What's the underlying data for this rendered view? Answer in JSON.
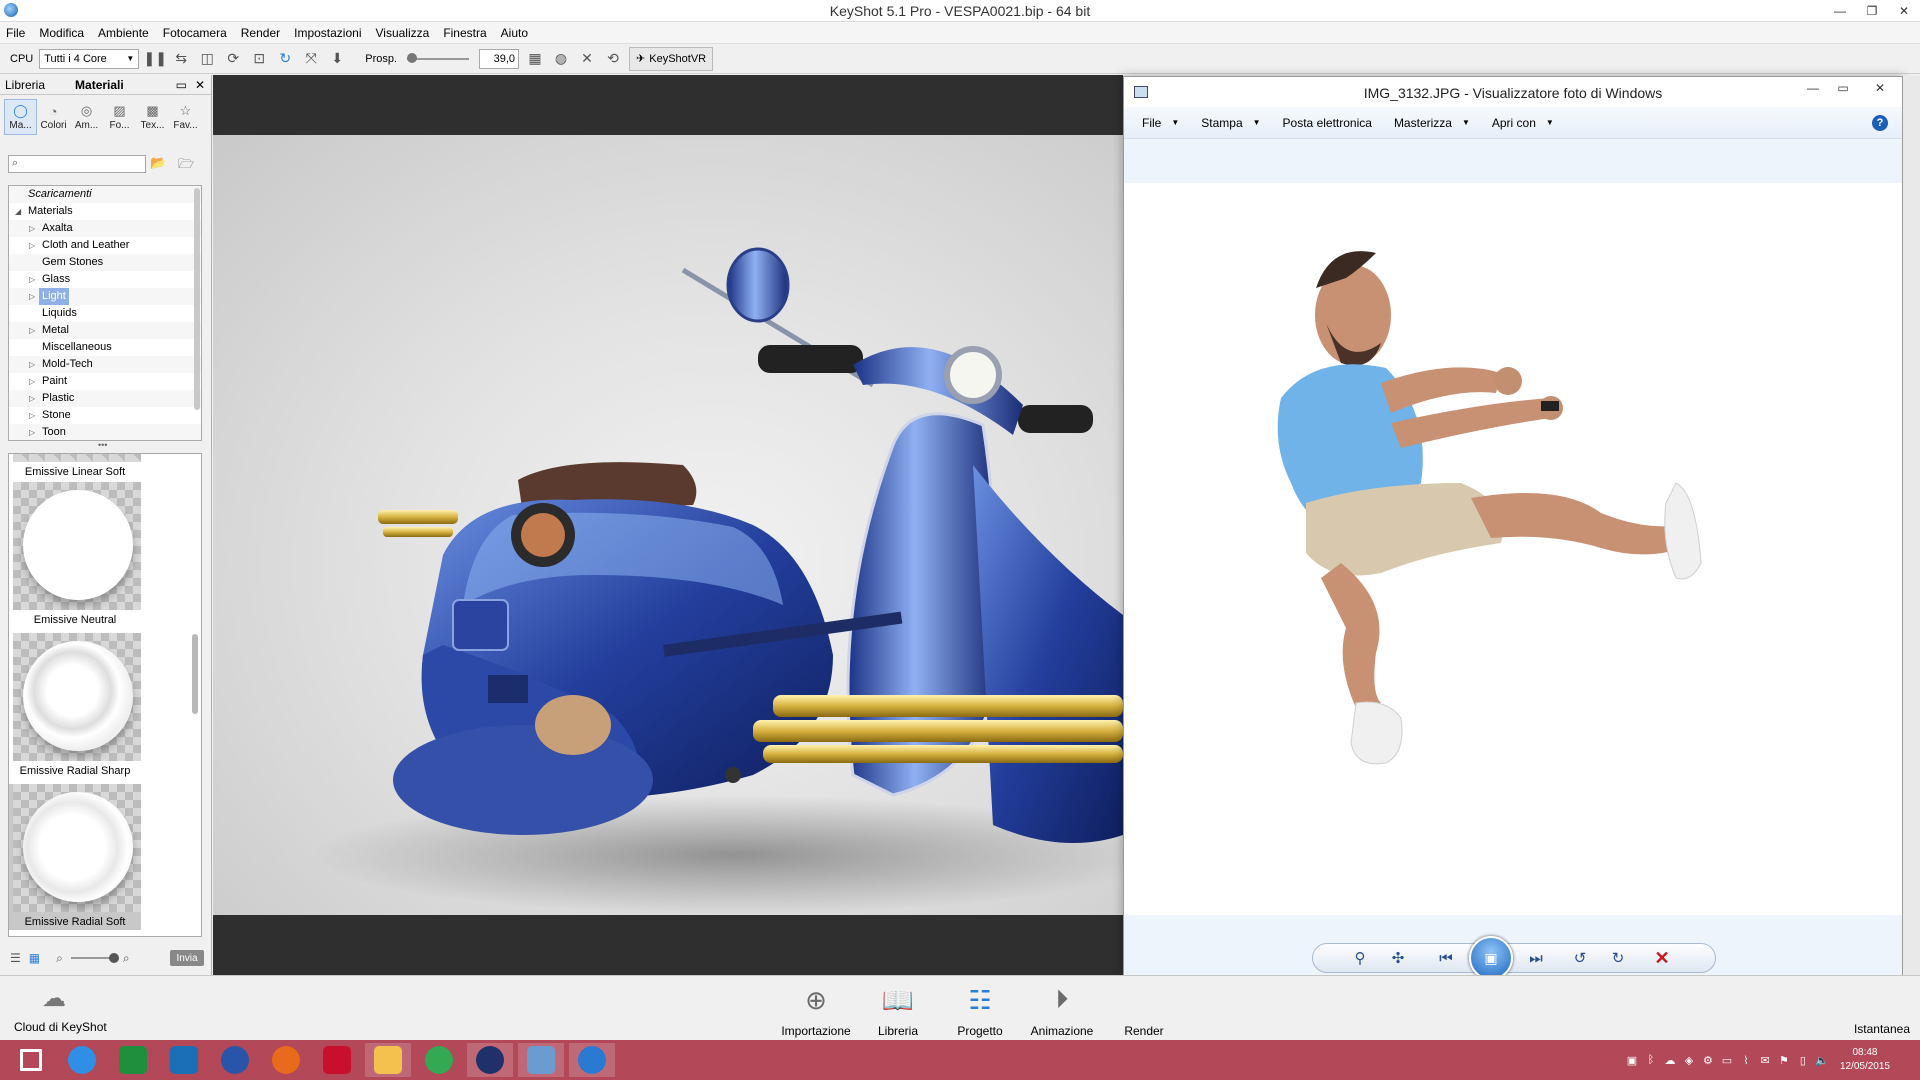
{
  "window": {
    "title": "KeyShot 5.1 Pro  - VESPA0021.bip  - 64 bit",
    "controls": [
      "—",
      "❐",
      "✕"
    ]
  },
  "menubar": [
    "File",
    "Modifica",
    "Ambiente",
    "Fotocamera",
    "Render",
    "Impostazioni",
    "Visualizza",
    "Finestra",
    "Aiuto"
  ],
  "toolbar": {
    "cpu_label": "CPU",
    "cpu_select": "Tutti i 4 Core",
    "persp_label": "Prosp.",
    "persp_value": "39,0",
    "keyshotvr_label": "KeyShotVR"
  },
  "library": {
    "tabs": [
      "Libreria",
      "Materiali"
    ],
    "categories": [
      {
        "label": "Ma...",
        "icon": "materials-icon"
      },
      {
        "label": "Colori",
        "icon": "colors-icon"
      },
      {
        "label": "Am...",
        "icon": "environments-icon"
      },
      {
        "label": "Fo...",
        "icon": "backplates-icon"
      },
      {
        "label": "Tex...",
        "icon": "textures-icon"
      },
      {
        "label": "Fav...",
        "icon": "favorites-icon"
      }
    ],
    "search_placeholder": "",
    "tree": [
      {
        "label": "Scaricamenti",
        "level": 0,
        "arrow": "",
        "italic": true
      },
      {
        "label": "Materials",
        "level": 0,
        "arrow": "◢"
      },
      {
        "label": "Axalta",
        "level": 1,
        "arrow": "▷"
      },
      {
        "label": "Cloth and Leather",
        "level": 1,
        "arrow": "▷"
      },
      {
        "label": "Gem Stones",
        "level": 1,
        "arrow": ""
      },
      {
        "label": "Glass",
        "level": 1,
        "arrow": "▷"
      },
      {
        "label": "Light",
        "level": 1,
        "arrow": "▷",
        "selected": true
      },
      {
        "label": "Liquids",
        "level": 1,
        "arrow": ""
      },
      {
        "label": "Metal",
        "level": 1,
        "arrow": "▷"
      },
      {
        "label": "Miscellaneous",
        "level": 1,
        "arrow": ""
      },
      {
        "label": "Mold-Tech",
        "level": 1,
        "arrow": "▷"
      },
      {
        "label": "Paint",
        "level": 1,
        "arrow": "▷"
      },
      {
        "label": "Plastic",
        "level": 1,
        "arrow": "▷"
      },
      {
        "label": "Stone",
        "level": 1,
        "arrow": "▷"
      },
      {
        "label": "Toon",
        "level": 1,
        "arrow": "▷"
      }
    ],
    "thumbnails": [
      {
        "label": "Emissive Linear Soft"
      },
      {
        "label": "Emissive Neutral"
      },
      {
        "label": "Emissive Radial Sharp"
      },
      {
        "label": "Emissive Radial Soft",
        "selected": true
      }
    ],
    "send_label": "Invia"
  },
  "dock": {
    "cloud_label": "Cloud di KeyShot",
    "items": [
      {
        "label": "Importazione",
        "icon": "import-icon"
      },
      {
        "label": "Libreria",
        "icon": "library-icon"
      },
      {
        "label": "Progetto",
        "icon": "project-icon"
      },
      {
        "label": "Animazione",
        "icon": "animation-icon"
      },
      {
        "label": "Render",
        "icon": "render-icon"
      }
    ],
    "snapshot_label": "Istantanea"
  },
  "viewer": {
    "title": "IMG_3132.JPG - Visualizzatore foto di Windows",
    "menu": [
      {
        "label": "File",
        "dropdown": true
      },
      {
        "label": "Stampa",
        "dropdown": true
      },
      {
        "label": "Posta elettronica",
        "dropdown": false
      },
      {
        "label": "Masterizza",
        "dropdown": true
      },
      {
        "label": "Apri con",
        "dropdown": true
      }
    ],
    "help": "?"
  },
  "taskbar": {
    "apps": [
      {
        "name": "windows-explorer-icon",
        "color": "#ffffff"
      },
      {
        "name": "internet-explorer-icon",
        "color": "#2f8ee5"
      },
      {
        "name": "store-icon",
        "color": "#1e8f3a"
      },
      {
        "name": "file-explorer-icon",
        "color": "#1a6fb5"
      },
      {
        "name": "compass-app-icon",
        "color": "#2855a8"
      },
      {
        "name": "firefox-icon",
        "color": "#e86a1c"
      },
      {
        "name": "acrobat-icon",
        "color": "#c8102e"
      },
      {
        "name": "folder-icon",
        "color": "#f2c14e"
      },
      {
        "name": "chrome-icon",
        "color": "#34a853"
      },
      {
        "name": "cinema4d-icon",
        "color": "#20306a"
      },
      {
        "name": "photo-viewer-icon",
        "color": "#6a9bd1"
      },
      {
        "name": "keyshot-icon",
        "color": "#2a7ad2"
      }
    ],
    "time": "08:48",
    "date": "12/05/2015"
  }
}
